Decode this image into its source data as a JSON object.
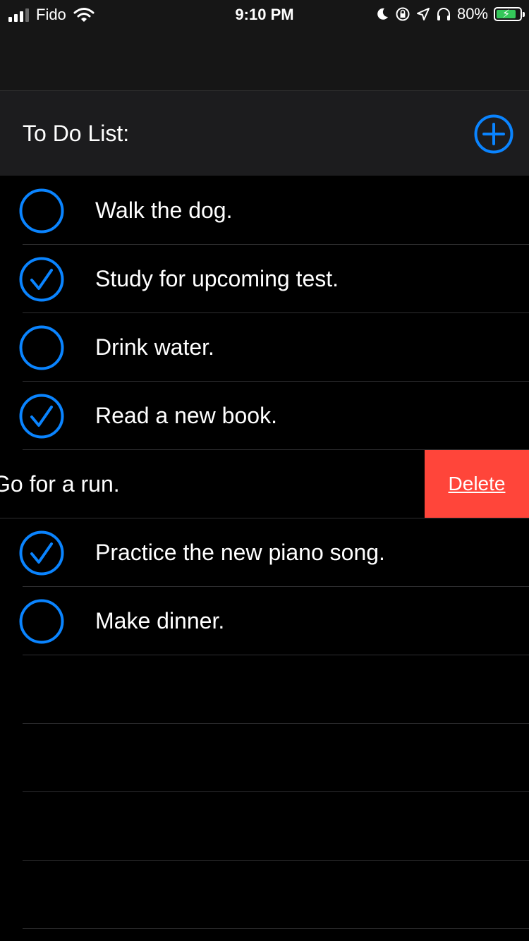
{
  "status_bar": {
    "carrier": "Fido",
    "time": "9:10 PM",
    "battery_percent": "80%",
    "icons": [
      "signal-icon",
      "wifi-icon",
      "moon-icon",
      "rotation-lock-icon",
      "location-icon",
      "headphones-icon",
      "battery-charging-icon"
    ]
  },
  "header": {
    "title": "To Do List:",
    "add_icon": "plus-circle-icon",
    "accent_color": "#0a84ff"
  },
  "todos": [
    {
      "text": "Walk the dog.",
      "done": false
    },
    {
      "text": "Study for upcoming test.",
      "done": true
    },
    {
      "text": "Drink water.",
      "done": false
    },
    {
      "text": "Read a new book.",
      "done": true
    },
    {
      "text": "Go for a run.",
      "done": false,
      "swiped": true
    },
    {
      "text": "Practice the new piano song.",
      "done": true
    },
    {
      "text": "Make dinner.",
      "done": false
    }
  ],
  "swipe_action": {
    "label": "Delete",
    "color": "#ff453a"
  }
}
